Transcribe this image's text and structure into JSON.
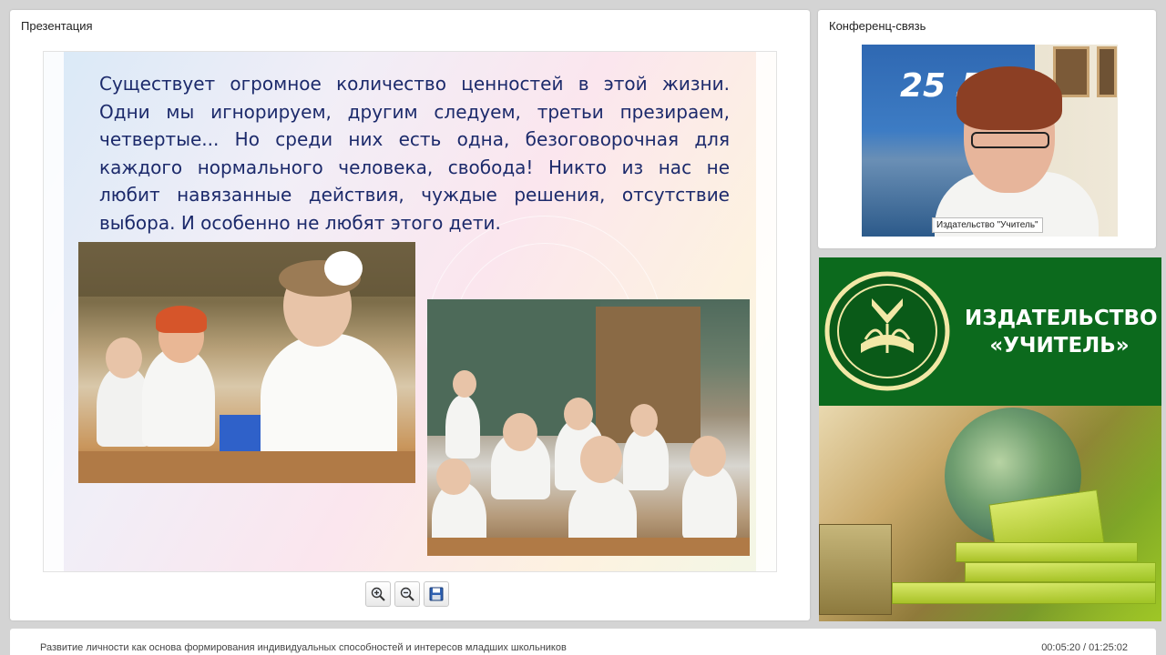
{
  "presentation": {
    "title": "Презентация",
    "slide": {
      "text": "Существует огромное количество ценностей в этой жизни. Одни мы игнорируем, другим следуем, третьи презираем, четвертые... Но среди них есть одна, безоговорочная для каждого нормального человека, свобода! Никто из нас не любит навязанные действия, чуждые решения, отсутствие выбора. И особенно не любят этого дети."
    },
    "tools": [
      {
        "name": "zoom-in",
        "icon": "zoom-in-icon"
      },
      {
        "name": "zoom-out",
        "icon": "zoom-out-icon"
      },
      {
        "name": "save",
        "icon": "save-icon"
      }
    ]
  },
  "conference": {
    "title": "Конференц-связь",
    "poster_text": "25 ЛЕТ",
    "caption": "Издательство \"Учитель\""
  },
  "brand": {
    "name_line1": "ИЗДАТЕЛЬСТВО",
    "name_line2": "«УЧИТЕЛЬ»",
    "colors": {
      "green": "#0c6a1d",
      "text": "#ffffff"
    }
  },
  "footer": {
    "title": "Развитие личности как основа формирования индивидуальных способностей и интересов младших школьников",
    "time": "00:05:20 / 01:25:02"
  }
}
